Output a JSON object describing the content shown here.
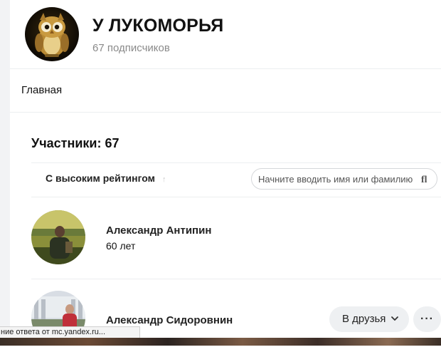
{
  "group": {
    "title": "У ЛУКОМОРЬЯ",
    "subscribers": "67 подписчиков",
    "avatar_icon": "owl-avatar-icon"
  },
  "tabs": [
    {
      "label": "Главная"
    }
  ],
  "members": {
    "title": "Участники: 67",
    "sort_label": "С высоким рейтингом",
    "search_placeholder": "Начните вводить имя или фамилию",
    "list": [
      {
        "name": "Александр Антипин",
        "age": "60 лет"
      },
      {
        "name": "Александр Сидоровнин"
      }
    ],
    "add_friend_label": "В друзья",
    "more_label": "···"
  },
  "status_bar": {
    "text": "ние ответа от mc.yandex.ru..."
  },
  "colors": {
    "accent_button_bg": "#eef0f2",
    "muted_text": "#8a8a8a",
    "separator": "#eceef0"
  }
}
